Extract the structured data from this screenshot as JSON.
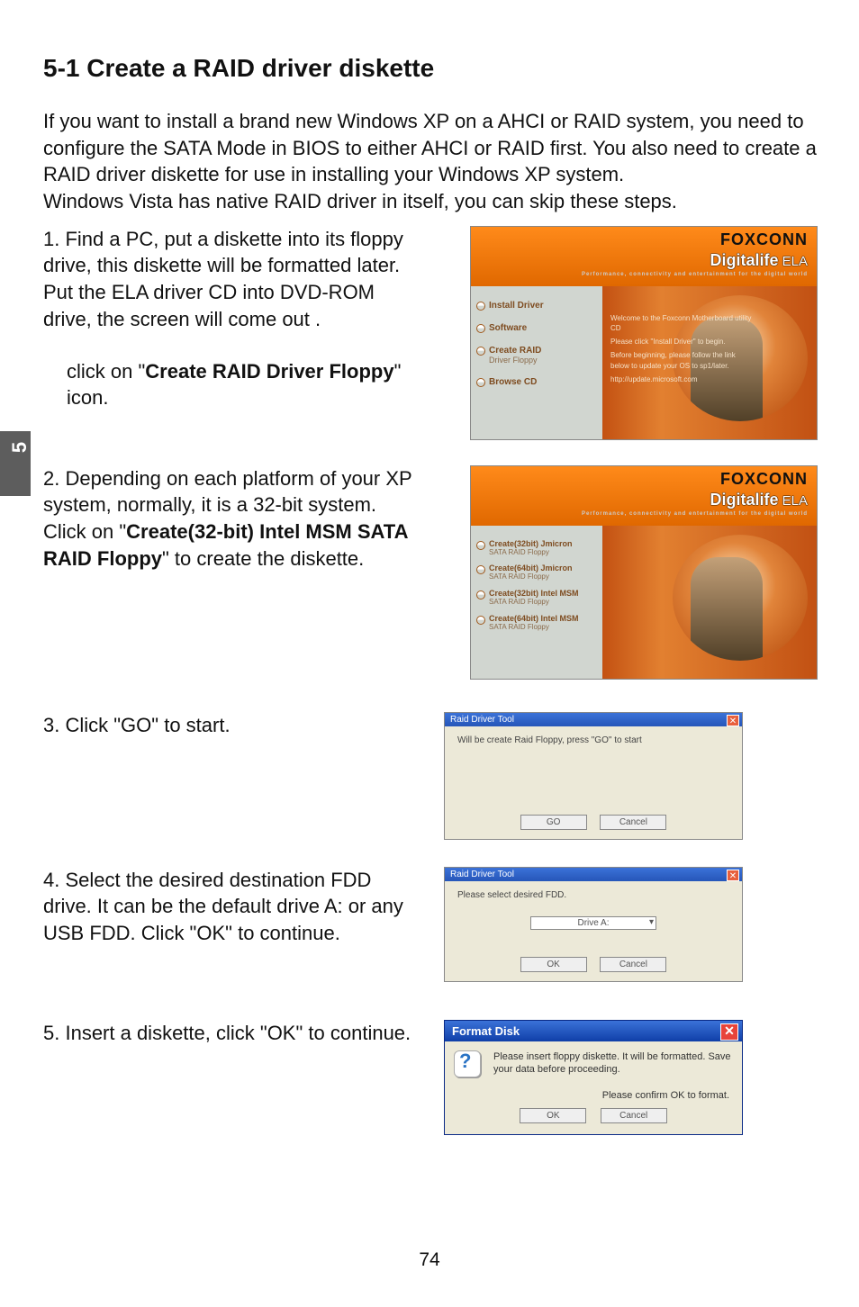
{
  "tab": "5",
  "page_number": "74",
  "heading": "5-1 Create a RAID driver diskette",
  "intro": "If you want to install a brand new Windows XP on a AHCI or RAID system, you need to configure the SATA Mode in BIOS to either AHCI or RAID first. You also need to create a RAID driver diskette for use in installing your Windows XP system.\nWindows Vista has native RAID driver in itself, you can skip these steps.",
  "steps": {
    "s1": {
      "num": "1. ",
      "text": "Find a PC, put a diskette into its floppy drive, this diskette will be formatted later. Put the ELA driver CD into DVD-ROM drive, the screen will come out .",
      "sub_pre": "click on \"",
      "sub_bold": "Create RAID Driver Floppy",
      "sub_post": "\" icon."
    },
    "s2": {
      "num": "2. ",
      "pre": "Depending on each platform of your XP system, normally, it is a 32-bit system. Click on \"",
      "bold": "Create(32-bit) Intel MSM SATA RAID Floppy",
      "post": "\" to create the diskette."
    },
    "s3": {
      "num": "3. ",
      "text": "Click \"GO\" to start."
    },
    "s4": {
      "num": "4. ",
      "text": "Select the desired destination FDD drive. It can be the default drive A: or any USB FDD. Click \"OK\" to continue."
    },
    "s5": {
      "num": "5. ",
      "text": "Insert a diskette, click \"OK\" to continue."
    }
  },
  "fx": {
    "brand": "FOXCONN",
    "sub": "Digitalife",
    "subela": " ELA",
    "tagline": "Performance, connectivity and entertainment for the digital world",
    "menu1": {
      "m0": "Install Driver",
      "m1": "Software",
      "m2": "Create RAID",
      "m2b": "Driver Floppy",
      "m3": "Browse CD"
    },
    "welcome": {
      "l0": "Welcome to the Foxconn Motherboard utility CD",
      "l1": "Please click \"Install Driver\" to begin.",
      "l2": "Before beginning, please follow the link below to update your OS to sp1/later.",
      "l3": "http://update.microsoft.com"
    },
    "menu2": {
      "m0a": "Create(32bit) Jmicron",
      "m0b": "SATA RAID Floppy",
      "m1a": "Create(64bit) Jmicron",
      "m1b": "SATA RAID Floppy",
      "m2a": "Create(32bit) Intel MSM",
      "m2b": "SATA RAID Floppy",
      "m3a": "Create(64bit) Intel MSM",
      "m3b": "SATA RAID Floppy"
    }
  },
  "dlg3": {
    "title": "Raid Driver Tool",
    "msg": "Will be create Raid Floppy, press \"GO\" to start",
    "go": "GO",
    "cancel": "Cancel"
  },
  "dlg4": {
    "title": "Raid Driver Tool",
    "msg": "Please select desired FDD.",
    "sel_label": "Drive A:",
    "ok": "OK",
    "cancel": "Cancel"
  },
  "dlg5": {
    "title": "Format Disk",
    "msg": "Please insert floppy diskette.  It will be formatted. Save your data before proceeding.",
    "confirm": "Please confirm OK to format.",
    "ok": "OK",
    "cancel": "Cancel"
  }
}
